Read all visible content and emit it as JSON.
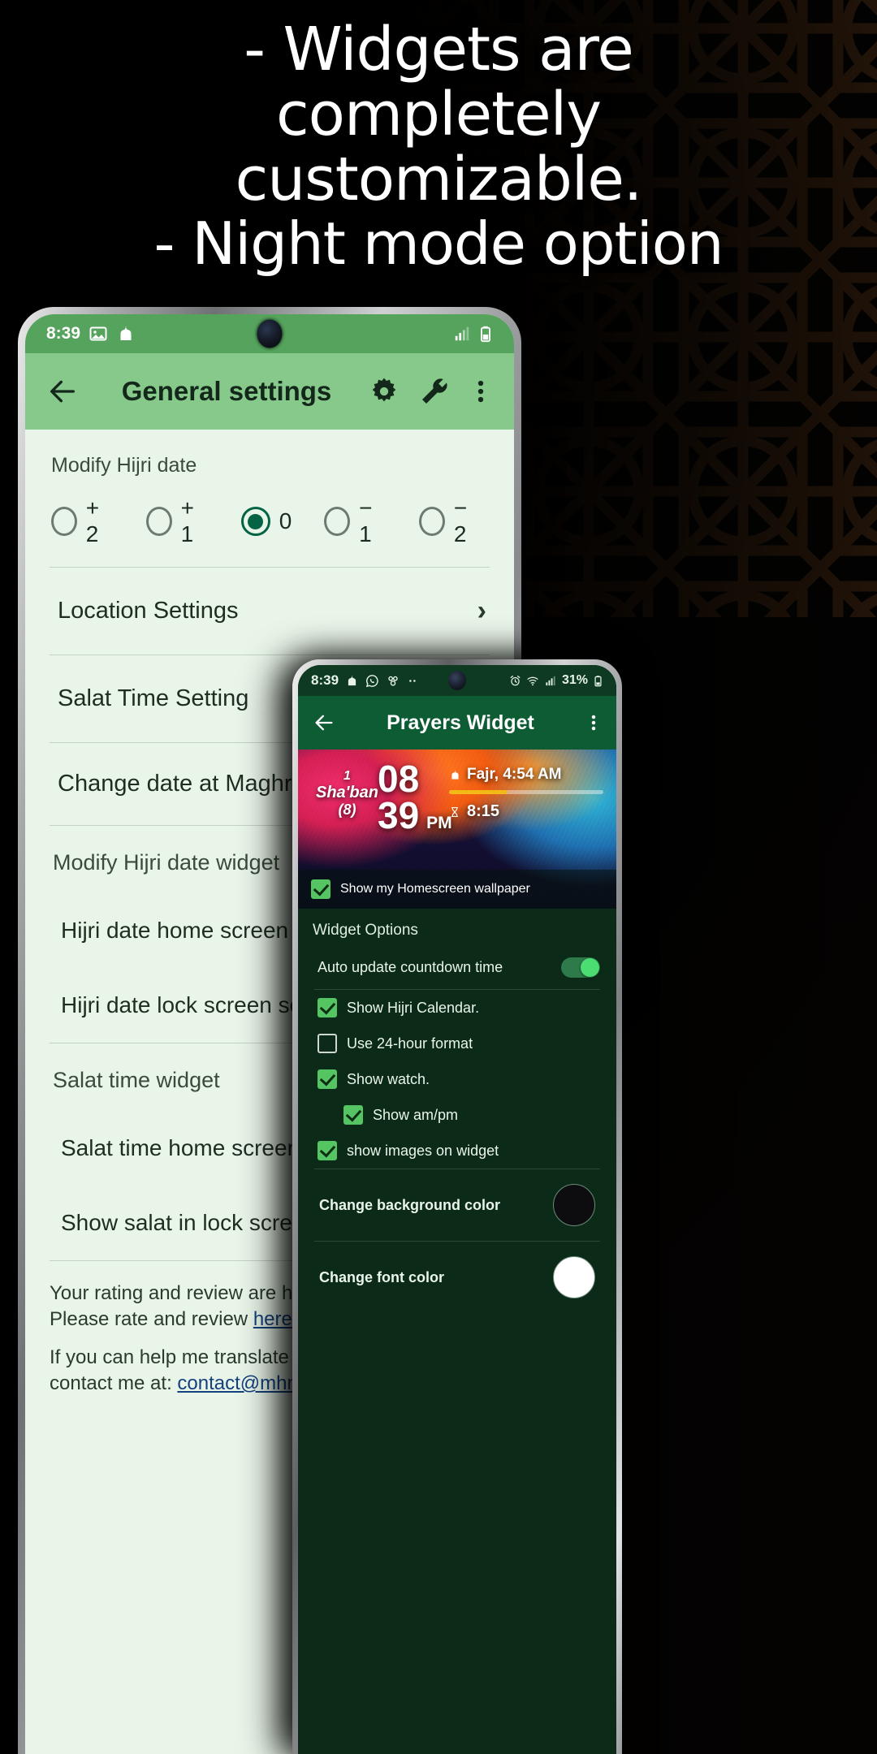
{
  "headline": {
    "line1": "- Widgets are",
    "line2": "completely",
    "line3": "customizable.",
    "line4": "- Night mode option"
  },
  "colors": {
    "brand_green": "#55a35c",
    "appbar_green": "#86c98a",
    "dark_green": "#0d5c33",
    "night_bg": "#0b2a17",
    "accent_check": "#55c463",
    "toggle_on": "#4bdc72",
    "radio_selected": "#046245",
    "progress_bar": "#f3b919",
    "background_swatch": "#0d0d10",
    "font_swatch": "#ffffff"
  },
  "phone1": {
    "status_bar": {
      "time": "8:39",
      "icons": [
        "image-icon",
        "mosque-icon"
      ],
      "right_icons": [
        "signal-icon",
        "battery-icon"
      ]
    },
    "app_bar": {
      "back": "back-arrow-icon",
      "title": "General settings",
      "actions": [
        "gear-icon",
        "wrench-icon",
        "overflow-menu-icon"
      ]
    },
    "hijri": {
      "label": "Modify Hijri date",
      "options": [
        {
          "label": "+ 2",
          "selected": false
        },
        {
          "label": "+ 1",
          "selected": false
        },
        {
          "label": "0",
          "selected": true
        },
        {
          "label": "− 1",
          "selected": false
        },
        {
          "label": "− 2",
          "selected": false
        }
      ]
    },
    "items": [
      {
        "label": "Location Settings",
        "chevron": "›"
      },
      {
        "label": "Salat Time Setting",
        "chevron": "›"
      }
    ],
    "maghrib_item": "Change date at Maghrib time",
    "group_hijri_widget": "Modify Hijri date widget",
    "hijri_widget_items": [
      "Hijri date home screen setting",
      "Hijri date lock screen setting"
    ],
    "group_salat_widget": "Salat time widget",
    "salat_widget_items": [
      "Salat time home screen widget",
      "Show salat in lock screen"
    ],
    "footer": {
      "line1": "Your rating and review are highly app",
      "line2_pre": "Please rate and review ",
      "line2_link": "here",
      "line2_post": ".",
      "line3": "If you can help me translate (or impro",
      "line4_pre": "contact me at: ",
      "line4_link": "contact@mhmmd.me"
    }
  },
  "phone2": {
    "status_bar": {
      "time": "8:39",
      "left_icons": [
        "mosque-icon",
        "whatsapp-icon",
        "apps-icon",
        "more-dots-icon"
      ],
      "right_icons": [
        "alarm-icon",
        "wifi-icon",
        "signal-icon",
        "battery-icon"
      ],
      "battery": "31%"
    },
    "app_bar": {
      "back": "back-arrow-icon",
      "title": "Prayers Widget",
      "actions": [
        "overflow-menu-icon"
      ]
    },
    "widget_preview": {
      "hijri_day": "1",
      "hijri_month": "Sha'ban",
      "hijri_month_number": "(8)",
      "clock_hours": "08",
      "clock_minutes": "39",
      "clock_ampm": "PM",
      "next_prayer": "Fajr, 4:54 AM",
      "countdown": "8:15",
      "progress_percent": 38,
      "wallpaper_option": "Show my Homescreen wallpaper",
      "wallpaper_checked": true
    },
    "widget_options_title": "Widget Options",
    "auto_update": {
      "label": "Auto update countdown time",
      "on": true
    },
    "checkboxes": [
      {
        "label": "Show Hijri Calendar.",
        "checked": true,
        "indent": false
      },
      {
        "label": "Use 24-hour format",
        "checked": false,
        "indent": false
      },
      {
        "label": "Show watch.",
        "checked": true,
        "indent": false
      },
      {
        "label": "Show am/pm",
        "checked": true,
        "indent": true
      },
      {
        "label": "show images on widget",
        "checked": true,
        "indent": false
      }
    ],
    "color_rows": [
      {
        "label": "Change background color",
        "color": "#0d0d10"
      },
      {
        "label": "Change font color",
        "color": "#ffffff"
      }
    ]
  }
}
